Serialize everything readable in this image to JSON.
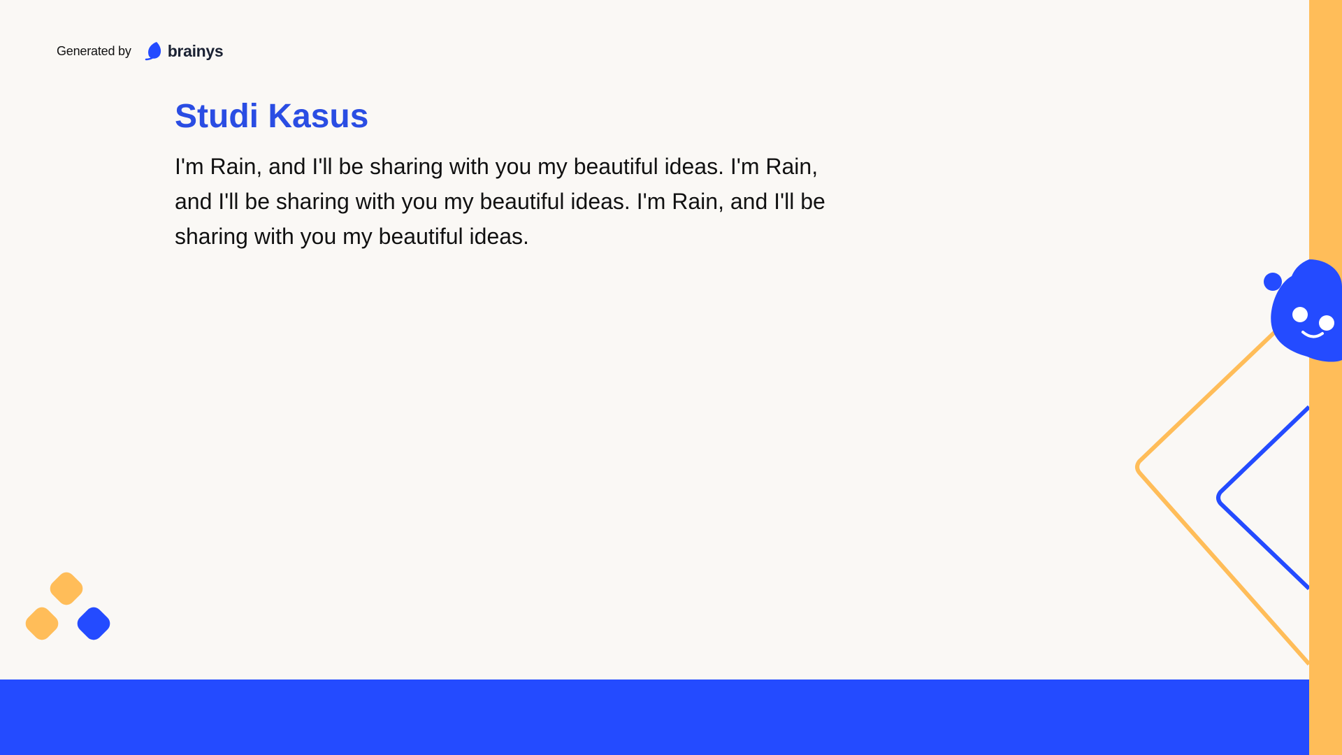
{
  "header": {
    "generated_by_label": "Generated by",
    "brand_name": "brainys",
    "logo_icon": "brainys-leaf-icon"
  },
  "slide": {
    "title": "Studi Kasus",
    "body": "I'm Rain, and I'll be sharing with you my beautiful ideas. I'm Rain, and I'll be sharing with you my beautiful ideas. I'm Rain, and I'll be sharing with you my beautiful ideas."
  },
  "colors": {
    "background": "#faf8f5",
    "accent_blue": "#244bff",
    "title_blue": "#2a4de3",
    "accent_orange": "#ffbd59",
    "text": "#111111"
  },
  "decorations": {
    "mascot_icon": "smiling-blob-mascot-icon",
    "corner_icon": "diamond-cluster-icon",
    "outline_icon": "chevron-outline-shapes"
  }
}
